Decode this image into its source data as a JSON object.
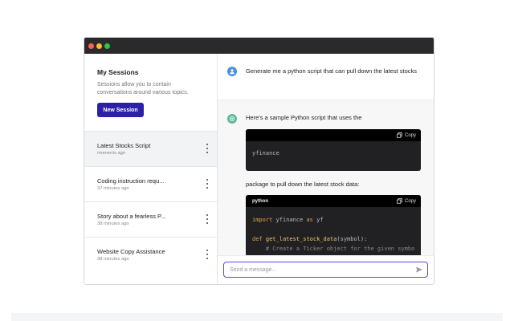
{
  "window": {
    "dots": [
      "#ff5f57",
      "#febc2e",
      "#28c840"
    ]
  },
  "sidebar": {
    "title": "My Sessions",
    "description": "Sessions allow you to contain conversations around various topics.",
    "new_session_label": "New Session",
    "sessions": [
      {
        "title": "Latest Stocks Script",
        "time": "moments ago",
        "active": true
      },
      {
        "title": "Coding instruction requ...",
        "time": "37 minutes ago",
        "active": false
      },
      {
        "title": "Story about a fearless P...",
        "time": "38 minutes ago",
        "active": false
      },
      {
        "title": "Website Copy Assistance",
        "time": "38 minutes ago",
        "active": false
      }
    ]
  },
  "chat": {
    "user_message": "Generate me a python script that can pull down the latest stocks",
    "bot_intro": "Here's a sample Python script that uses the",
    "code1": {
      "lang": "",
      "copy_label": "Copy",
      "code": "yfinance"
    },
    "bot_text2": "package to pull down the latest stock data:",
    "code2": {
      "lang": "python",
      "copy_label": "Copy",
      "line1_kw": "import",
      "line1_rest": " yfinance ",
      "line1_as": "as",
      "line1_alias": " yf",
      "line3_kw": "def",
      "line3_fn": "get_latest_stock_data",
      "line3_rest": "(symbol):",
      "line4": "    # Create a Ticker object for the given symbo"
    }
  },
  "input": {
    "placeholder": "Send a message..."
  },
  "colors": {
    "accent": "#2c1fa8",
    "input_border": "#5b4bd6",
    "user_avatar": "#4a90e2",
    "bot_avatar": "#5fb89a"
  }
}
